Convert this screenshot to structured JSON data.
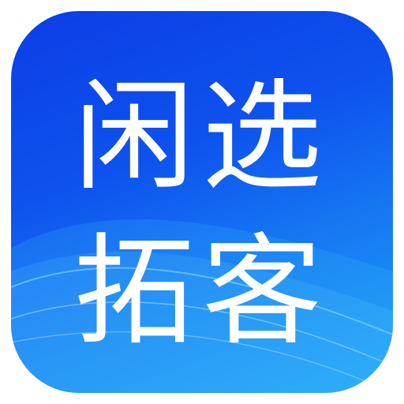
{
  "app_icon": {
    "line1": "闲选",
    "line2": "拓客",
    "colors": {
      "background_top": "#0b3ee6",
      "background_bottom": "#1ea5f6",
      "text": "#ffffff"
    }
  }
}
